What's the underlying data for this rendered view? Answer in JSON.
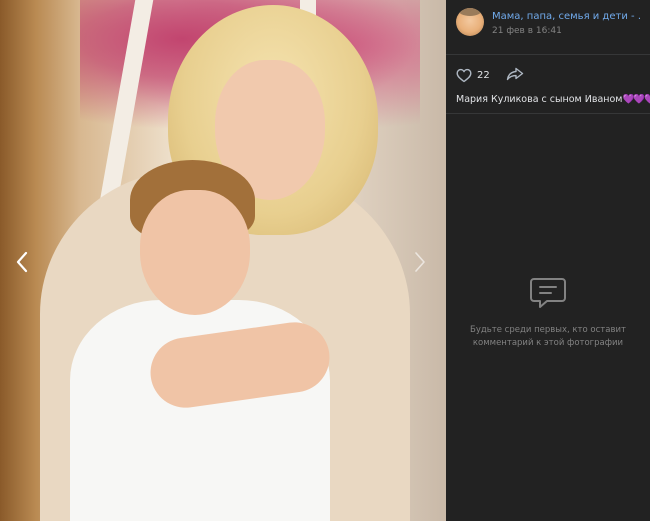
{
  "post": {
    "group_name": "Мама, папа, семья и дети - моё сча...",
    "date": "21 фев в 16:41",
    "likes": "22",
    "caption_text": "Мария Куликова с сыном Иваном",
    "caption_emoji": "💜💜💜"
  },
  "comments": {
    "empty_text": "Будьте среди первых, кто оставит комментарий к этой фотографии"
  },
  "icons": {
    "prev": "chevron-left-icon",
    "next": "chevron-right-icon",
    "like": "heart-icon",
    "share": "share-arrow-icon",
    "comments": "comment-bubble-icon"
  },
  "colors": {
    "sidebar_bg": "#222222",
    "link": "#71aaeb",
    "muted": "#828282",
    "text": "#e1e3e6",
    "emoji": "#b566e8"
  }
}
